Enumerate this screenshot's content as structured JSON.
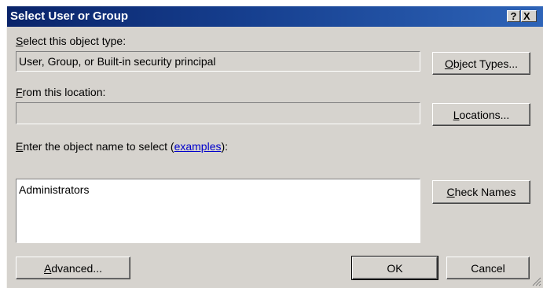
{
  "window": {
    "title": "Select User or Group",
    "help_glyph": "?",
    "close_glyph": "X"
  },
  "object_type": {
    "label_mnemonic": "S",
    "label_rest": "elect this object type:",
    "value": "User, Group, or Built-in security principal",
    "button_mnemonic": "O",
    "button_rest": "bject Types..."
  },
  "location": {
    "label_mnemonic": "F",
    "label_rest": "rom this location:",
    "value": "",
    "button_mnemonic": "L",
    "button_rest": "ocations..."
  },
  "object_name": {
    "label_mnemonic": "E",
    "label_rest": "nter the object name to select (",
    "link": "examples",
    "label_end": "):",
    "value": "Administrators",
    "check_mnemonic": "C",
    "check_rest": "heck Names"
  },
  "footer": {
    "advanced_mnemonic": "A",
    "advanced_rest": "dvanced...",
    "ok_label": "OK",
    "cancel_label": "Cancel"
  },
  "icons": {
    "help": "help-icon",
    "close": "close-icon",
    "grip": "resize-grip-icon"
  },
  "colors": {
    "titlebar_start": "#0a246a",
    "titlebar_end": "#2e64b8",
    "dialog_face": "#d6d3ce",
    "link": "#0000cc"
  }
}
